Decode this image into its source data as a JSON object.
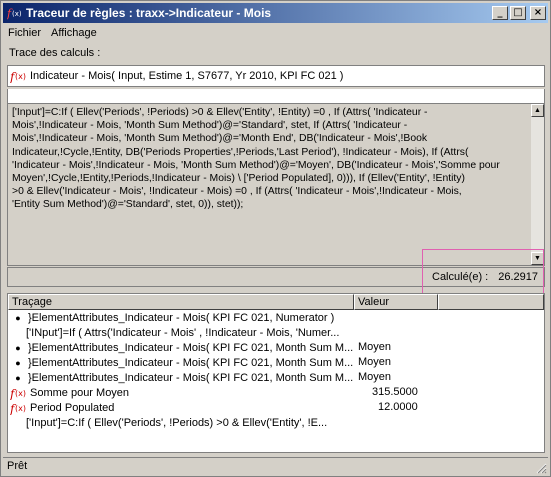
{
  "window": {
    "title": "Traceur de règles : traxx->Indicateur - Mois"
  },
  "menu": {
    "items": [
      "Fichier",
      "Affichage"
    ]
  },
  "trace": {
    "label": "Trace des calculs :",
    "formula": "Indicateur - Mois( Input, Estime 1, S7677, Yr 2010, KPI FC 021 )",
    "expression_lines": [
      "['Input']=C:If ( Ellev('Periods', !Periods) >0 &      Ellev('Entity', !Entity) =0 ,   If (Attrs( 'Indicateur -",
      "Mois',!Indicateur - Mois, 'Month Sum Method')@='Standard',         stet,    If (Attrs( 'Indicateur -",
      "Mois',!Indicateur - Mois, 'Month Sum Method')@='Month End',    DB('Indicateur - Mois',!Book",
      "Indicateur,!Cycle,!Entity, DB('Periods Properties',!Periods,'Last Period'),      !Indicateur - Mois),     If (Attrs(",
      "'Indicateur - Mois',!Indicateur - Mois, 'Month Sum Method')@='Moyen',    DB('Indicateur - Mois','Somme pour",
      "Moyen',!Cycle,!Entity,!Periods,!Indicateur - Mois) \\   ['Period Populated],     0))),  If (Ellev('Entity', !Entity)",
      ">0 &      Ellev('Indicateur - Mois', !Indicateur - Mois) =0 ,   If (Attrs( 'Indicateur - Mois',!Indicateur - Mois,",
      "'Entity Sum Method')@='Standard',         stet,         0)),  stet));"
    ],
    "result_label": "Calculé(e) :",
    "result_value": "26.2917"
  },
  "tree": {
    "columns": [
      "Traçage",
      "Valeur"
    ],
    "rows": [
      {
        "indent": 0,
        "icon": "bullet",
        "text": "}ElementAttributes_Indicateur - Mois( KPI FC 021, Numerator )",
        "value": ""
      },
      {
        "indent": 1,
        "icon": "none",
        "text": "['INput']=If ( Attrs('Indicateur - Mois' , !Indicateur - Mois, 'Numer...",
        "value": ""
      },
      {
        "indent": 0,
        "icon": "bullet",
        "text": "}ElementAttributes_Indicateur - Mois( KPI FC 021, Month Sum M...",
        "value": "Moyen"
      },
      {
        "indent": 0,
        "icon": "bullet",
        "text": "}ElementAttributes_Indicateur - Mois( KPI FC 021, Month Sum M...",
        "value": "Moyen"
      },
      {
        "indent": 0,
        "icon": "bullet",
        "text": "}ElementAttributes_Indicateur - Mois( KPI FC 021, Month Sum M...",
        "value": "Moyen"
      },
      {
        "indent": 0,
        "icon": "fx",
        "text": "Somme pour Moyen",
        "value": "315.5000"
      },
      {
        "indent": 0,
        "icon": "fx",
        "text": "Period Populated",
        "value": "12.0000"
      },
      {
        "indent": 1,
        "icon": "none",
        "text": "['Input']=C:If ( Ellev('Periods', !Periods) >0 &      Ellev('Entity', !E...",
        "value": ""
      }
    ]
  },
  "status": {
    "text": "Prêt"
  },
  "colors": {
    "title_start": "#0a246a",
    "title_end": "#a6caf0",
    "highlight": "#e060b0",
    "fx_red": "#cc0000"
  }
}
